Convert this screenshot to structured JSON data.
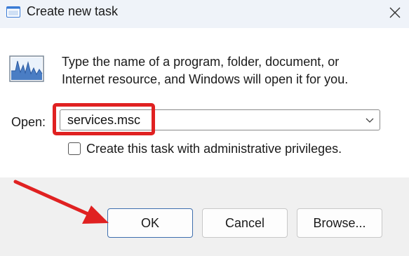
{
  "window": {
    "title": "Create new task",
    "close_icon": "close-icon"
  },
  "description": {
    "line1": "Type the name of a program, folder, document, or",
    "line2": "Internet resource, and Windows will open it for you."
  },
  "open_field": {
    "label": "Open:",
    "value": "services.msc"
  },
  "admin_checkbox": {
    "label": "Create this task with administrative privileges.",
    "checked": false
  },
  "buttons": {
    "ok": "OK",
    "cancel": "Cancel",
    "browse": "Browse..."
  },
  "colors": {
    "annotation_red": "#e02121",
    "ok_border": "#3f6fae"
  }
}
